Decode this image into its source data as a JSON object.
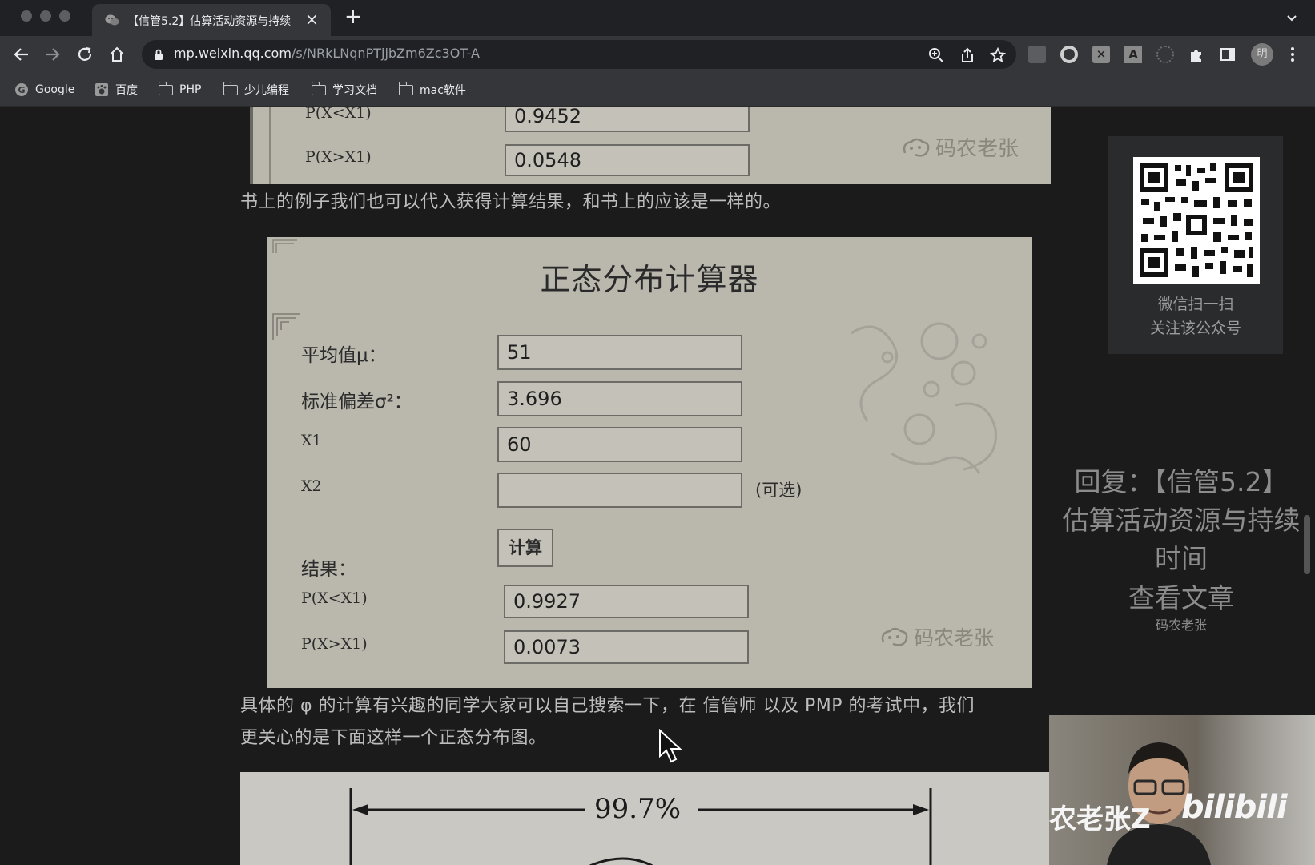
{
  "browser": {
    "tab_title": "【信管5.2】估算活动资源与持续",
    "url_host": "mp.weixin.qq.com",
    "url_path": "/s/NRkLNqnPTjjbZm6Zc3OT-A",
    "avatar_initial": "明",
    "bookmarks": [
      {
        "label": "Google",
        "icon": "google-icon"
      },
      {
        "label": "百度",
        "icon": "baidu-icon"
      },
      {
        "label": "PHP",
        "icon": "folder-icon"
      },
      {
        "label": "少儿编程",
        "icon": "folder-icon"
      },
      {
        "label": "学习文档",
        "icon": "folder-icon"
      },
      {
        "label": "mac软件",
        "icon": "folder-icon"
      }
    ]
  },
  "article": {
    "calc1": {
      "rows": [
        {
          "label": "P(X<X1)",
          "value": "0.9452"
        },
        {
          "label": "P(X>X1)",
          "value": "0.0548"
        }
      ],
      "watermark": "码农老张"
    },
    "para1": "书上的例子我们也可以代入获得计算结果，和书上的应该是一样的。",
    "calc2": {
      "title": "正态分布计算器",
      "mean_label": "平均值μ：",
      "mean_value": "51",
      "sd_label": "标准偏差σ²：",
      "sd_value": "3.696",
      "x1_label": "X1",
      "x1_value": "60",
      "x2_label": "X2",
      "x2_value": "",
      "optional": "(可选)",
      "button": "计算",
      "result_label": "结果：",
      "results": [
        {
          "label": "P(X<X1)",
          "value": "0.9927"
        },
        {
          "label": "P(X>X1)",
          "value": "0.0073"
        }
      ],
      "watermark": "码农老张"
    },
    "para2_line1": "具体的 φ 的计算有兴趣的同学大家可以自己搜索一下，在 信管师 以及 PMP 的考试中，我们",
    "para2_line2": "更关心的是下面这样一个正态分布图。",
    "figure_label": "99.7%"
  },
  "sidebar": {
    "qr_line1": "微信扫一扫",
    "qr_line2": "关注该公众号",
    "reply_line1": "回复：【信管5.2】",
    "reply_line2": "估算活动资源与持续",
    "reply_line3": "时间",
    "reply_line4": "查看文章",
    "reply_author": "码农老张"
  },
  "webcam": {
    "overlay_name": "农老张Z",
    "overlay_logo": "bilibili"
  }
}
